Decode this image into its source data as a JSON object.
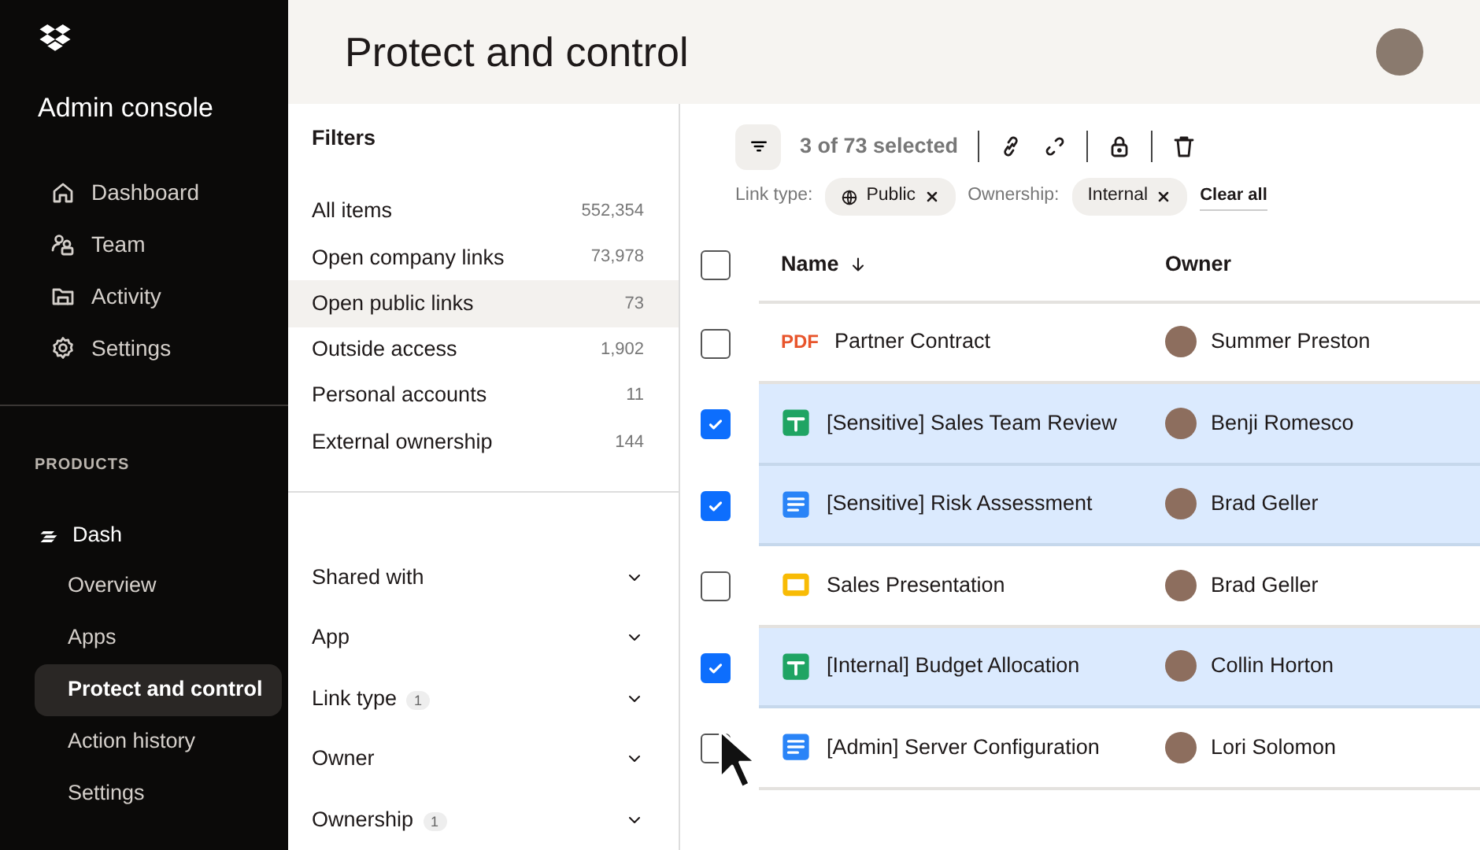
{
  "sidebar": {
    "title": "Admin console",
    "nav": [
      {
        "label": "Dashboard"
      },
      {
        "label": "Team"
      },
      {
        "label": "Activity"
      },
      {
        "label": "Settings"
      }
    ],
    "section_label": "PRODUCTS",
    "product": {
      "label": "Dash"
    },
    "product_items": [
      {
        "label": "Overview",
        "selected": false
      },
      {
        "label": "Apps",
        "selected": false
      },
      {
        "label": "Protect and control",
        "selected": true
      },
      {
        "label": "Action history",
        "selected": false
      },
      {
        "label": "Settings",
        "selected": false
      }
    ]
  },
  "header": {
    "title": "Protect and control"
  },
  "filters": {
    "title": "Filters",
    "quick": [
      {
        "label": "All items",
        "count": "552,354",
        "selected": false
      },
      {
        "label": "Open company links",
        "count": "73,978",
        "selected": false
      },
      {
        "label": "Open public links",
        "count": "73",
        "selected": true
      },
      {
        "label": "Outside access",
        "count": "1,902",
        "selected": false
      },
      {
        "label": "Personal accounts",
        "count": "11",
        "selected": false
      },
      {
        "label": "External ownership",
        "count": "144",
        "selected": false
      }
    ],
    "dropdowns": [
      {
        "label": "Shared with"
      },
      {
        "label": "App"
      },
      {
        "label": "Link type",
        "badge": "1"
      },
      {
        "label": "Owner"
      },
      {
        "label": "Ownership",
        "badge": "1"
      }
    ]
  },
  "toolbar": {
    "selection": "3 of 73 selected"
  },
  "active_filters": [
    {
      "label": "Link type:",
      "chip": "Public",
      "globe": true
    },
    {
      "label": "Ownership:",
      "chip": "Internal",
      "globe": false
    }
  ],
  "clear_all": "Clear all",
  "table": {
    "columns": [
      "Name",
      "Owner"
    ],
    "all_checked": false,
    "rows": [
      {
        "kind": "pdf",
        "file_label": "PDF",
        "name": "Partner Contract",
        "owner": "Summer Preston",
        "checked": false
      },
      {
        "kind": "sheet",
        "name": "[Sensitive] Sales Team Review",
        "owner": "Benji Romesco",
        "checked": true
      },
      {
        "kind": "doc",
        "name": "[Sensitive] Risk Assessment",
        "owner": "Brad Geller",
        "checked": true
      },
      {
        "kind": "slides",
        "name": "Sales Presentation",
        "owner": "Brad Geller",
        "checked": false
      },
      {
        "kind": "sheet",
        "name": "[Internal] Budget Allocation",
        "owner": "Collin Horton",
        "checked": true
      },
      {
        "kind": "doc",
        "name": "[Admin] Server Configuration",
        "owner": "Lori Solomon",
        "checked": false
      }
    ]
  }
}
